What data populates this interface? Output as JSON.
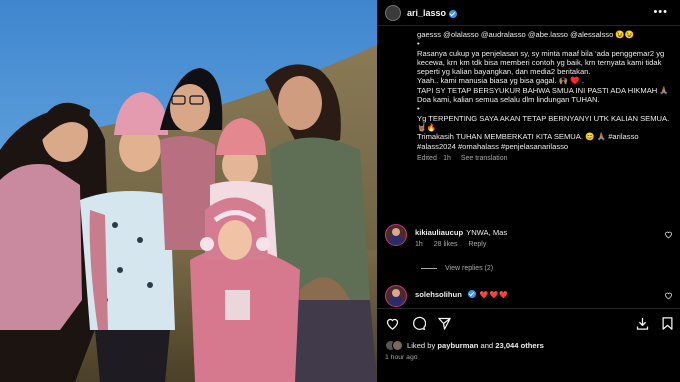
{
  "post": {
    "username": "ari_lasso",
    "more_icon": "more-horizontal-icon",
    "caption_lines": [
      "gaesss @olalasso @audralasso @abe.lasso @alessalsso 😉😉",
      "•",
      "Rasanya cukup ya penjelasan sy, sy minta maaf bila ‘ada penggemar2 yg kecewa, krn km tdk bisa memberi contoh yg baik, krn ternyata kami tidak seperti yg kalian bayangkan, dan media2 beritakan.",
      "Yaah.. kami manusia biasa yg bisa gagal. 🙌🏽 ♥️ .",
      "TAPI SY TETAP BERSYUKUR BAHWA SMUA INI PASTI ADA HIKMAH 🙏🏽",
      "Doa kami, kalian semua selalu dlm lindungan TUHAN.",
      "•",
      "Yg TERPENTING SAYA AKAN TETAP BERNYANYI UTK KALIAN SEMUA. 🤘🏽🔥",
      "Trimakasih TUHAN MEMBERKATI KITA SEMUA. 😊 🙏🏽 #arilasso #alass2024 #omahalass #penjelasanarilasso"
    ],
    "caption_meta": {
      "edited": "Edited · 1h",
      "see_translation": "See translation"
    }
  },
  "comments": [
    {
      "username": "kikiauliaucup",
      "text": "YNWA, Mas",
      "time": "1h",
      "likes": "28 likes",
      "reply": "Reply",
      "view_replies": "View replies (2)"
    },
    {
      "username": "solehsolihun",
      "text": "❤️❤️❤️"
    }
  ],
  "actions": {
    "like_icon": "heart-icon",
    "comment_icon": "comment-icon",
    "share_icon": "send-icon",
    "save_icon": "bookmark-icon"
  },
  "likes": {
    "prefix": "Liked by",
    "user": "payburman",
    "middle": "and",
    "count": "23,044 others"
  },
  "timestamp": "1 hour ago",
  "colors": {
    "verified": "#3897f0",
    "heart": "#ed4956",
    "background": "#000000",
    "muted": "#a8a8a8"
  }
}
